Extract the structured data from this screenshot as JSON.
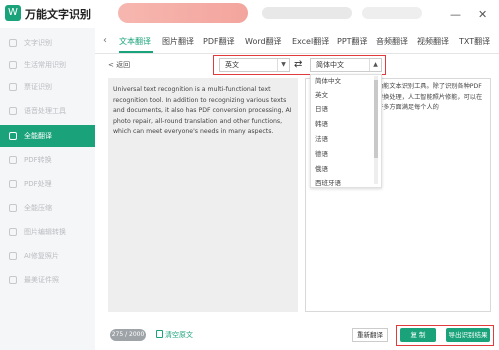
{
  "app": {
    "title": "万能文字识别",
    "logo_glyph": "W"
  },
  "sidebar": {
    "items": [
      {
        "label": "文字识别"
      },
      {
        "label": "生活常用识别"
      },
      {
        "label": "票证识别"
      },
      {
        "label": "语音处理工具"
      },
      {
        "label": "全能翻译",
        "active": true
      },
      {
        "label": "PDF转换"
      },
      {
        "label": "PDF处理"
      },
      {
        "label": "全能压缩"
      },
      {
        "label": "图片编辑转换"
      },
      {
        "label": "AI修复照片"
      },
      {
        "label": "最美证件照"
      }
    ]
  },
  "tabs": [
    {
      "label": "文本翻译",
      "active": true
    },
    {
      "label": "图片翻译"
    },
    {
      "label": "PDF翻译"
    },
    {
      "label": "Word翻译"
    },
    {
      "label": "Excel翻译"
    },
    {
      "label": "PPT翻译"
    },
    {
      "label": "音频翻译"
    },
    {
      "label": "视频翻译"
    },
    {
      "label": "TXT翻译"
    }
  ],
  "nav": {
    "back_label": "< 返回"
  },
  "source_lang": {
    "value": "英文"
  },
  "target_lang": {
    "value": "简体中文"
  },
  "source_text": "Universal text recognition is a multi-functional text recognition tool. In addition to recognizing various texts and documents, it also has PDF conversion processing, AI photo repair, all-round translation and other functions, which can meet everyone's needs in many aspects.",
  "result_text": "功能文本识别工具。除了识别各种PDF转换处理，人工智能照片修能，可以在许多方面满足每个人的",
  "dropdown": {
    "options": [
      "简体中文",
      "英文",
      "日语",
      "韩语",
      "法语",
      "德语",
      "俄语",
      "西班牙语"
    ]
  },
  "footer": {
    "counter": "275 / 2000",
    "clear_label": "清空原文",
    "retranslate_label": "重新翻译",
    "copy_label": "复 制",
    "export_label": "导出识别结果"
  },
  "colors": {
    "accent": "#1aa37a",
    "highlight": "#e23b3b"
  }
}
